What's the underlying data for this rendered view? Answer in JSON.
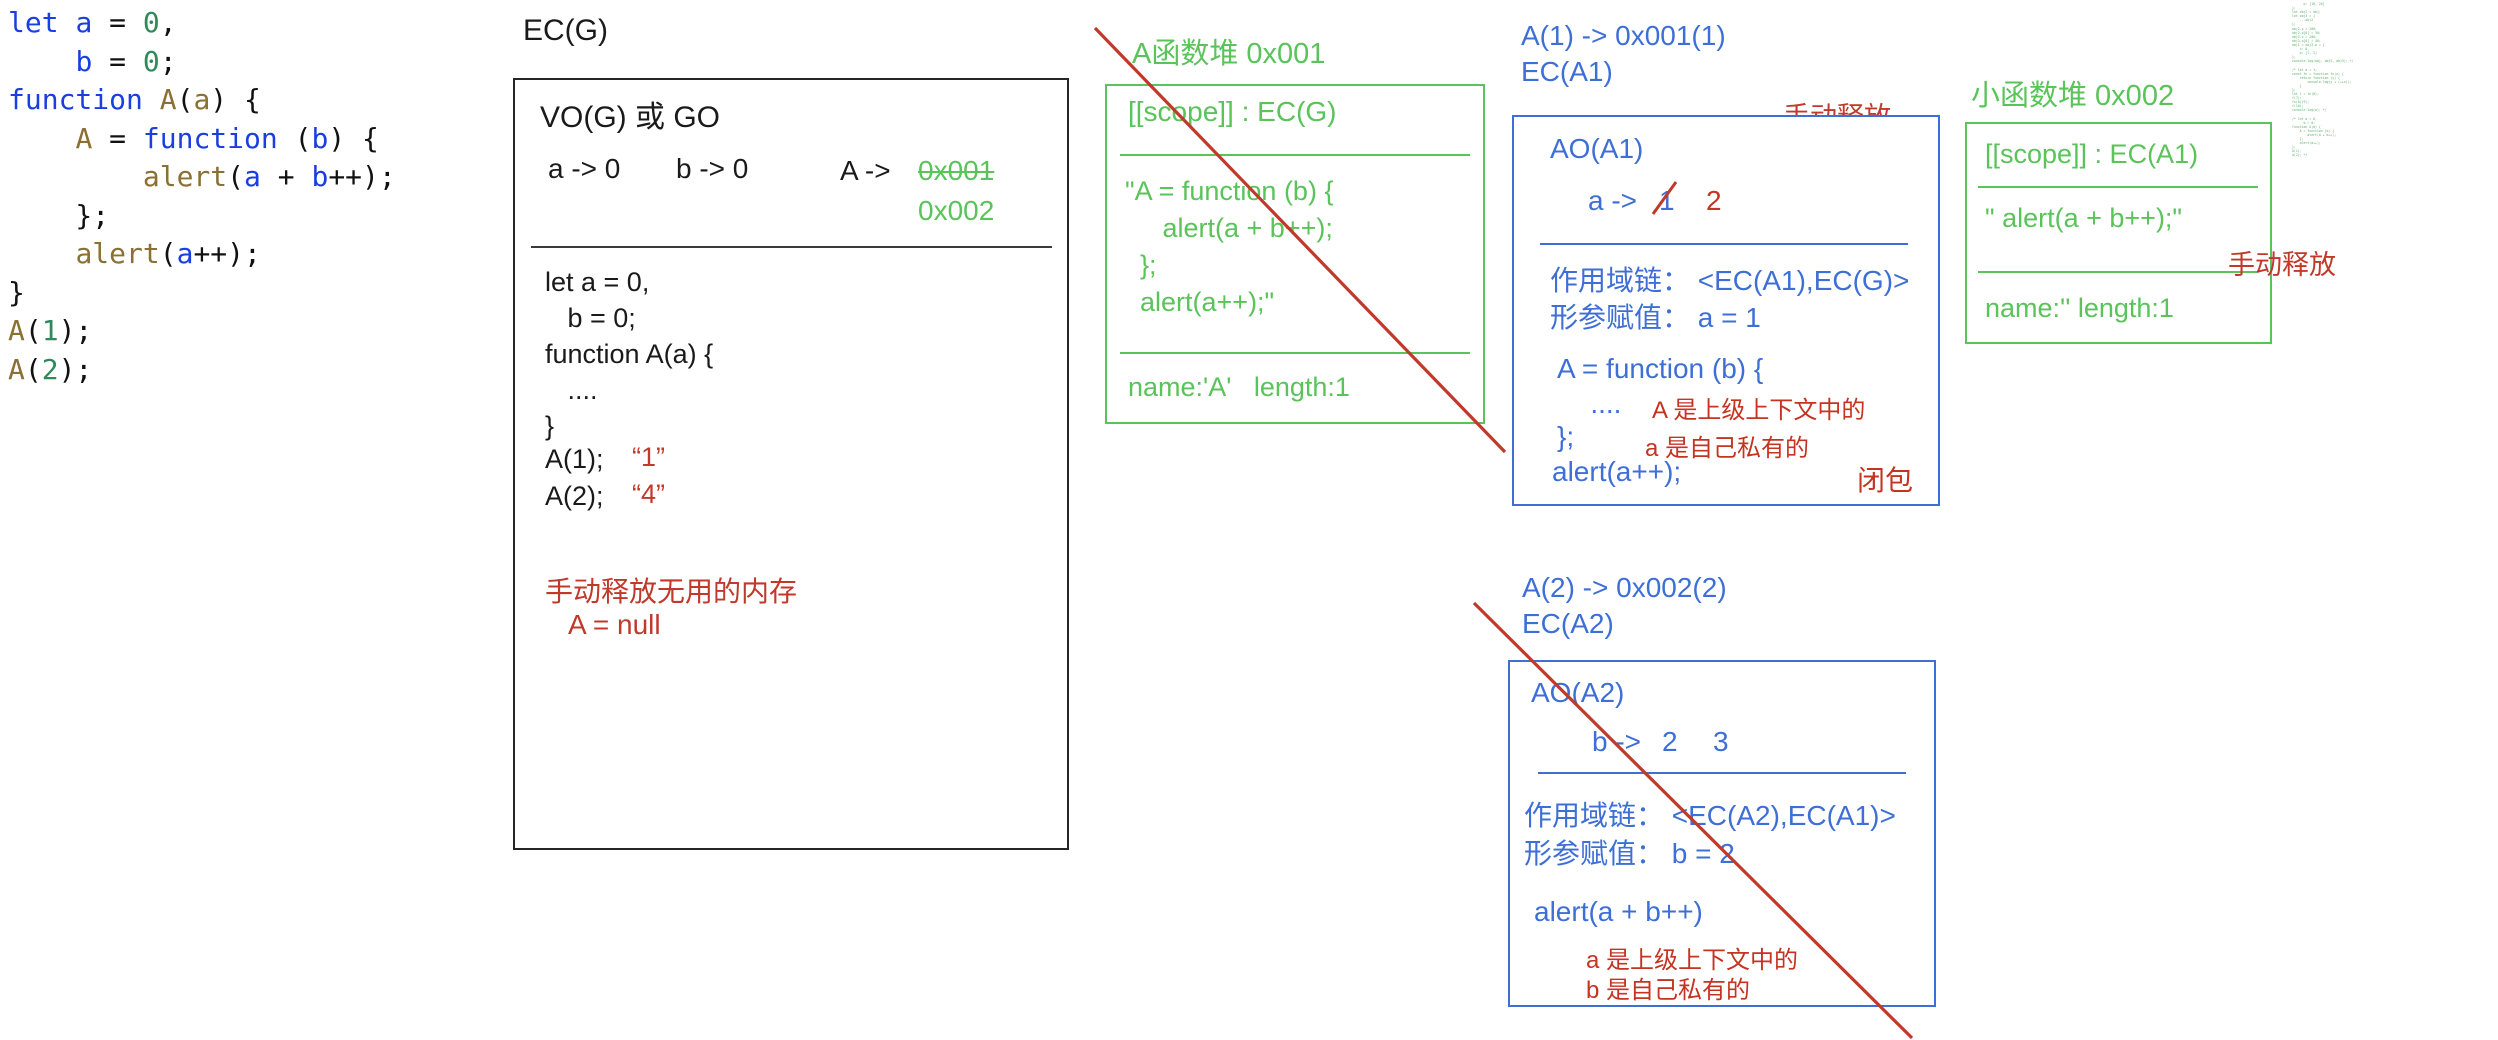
{
  "source_code": {
    "lines": [
      [
        {
          "t": "let ",
          "c": "kw"
        },
        {
          "t": "a",
          "c": "var"
        },
        {
          "t": " = ",
          "c": "pl"
        },
        {
          "t": "0",
          "c": "num"
        },
        {
          "t": ",",
          "c": "pl"
        }
      ],
      [
        {
          "t": "    ",
          "c": "pl"
        },
        {
          "t": "b",
          "c": "var"
        },
        {
          "t": " = ",
          "c": "pl"
        },
        {
          "t": "0",
          "c": "num"
        },
        {
          "t": ";",
          "c": "pl"
        }
      ],
      [
        {
          "t": "function ",
          "c": "kw"
        },
        {
          "t": "A",
          "c": "fn"
        },
        {
          "t": "(",
          "c": "pl"
        },
        {
          "t": "a",
          "c": "fn"
        },
        {
          "t": ") {",
          "c": "pl"
        }
      ],
      [
        {
          "t": "    ",
          "c": "pl"
        },
        {
          "t": "A",
          "c": "fn"
        },
        {
          "t": " = ",
          "c": "pl"
        },
        {
          "t": "function ",
          "c": "kw"
        },
        {
          "t": "(",
          "c": "pl"
        },
        {
          "t": "b",
          "c": "var"
        },
        {
          "t": ") {",
          "c": "pl"
        }
      ],
      [
        {
          "t": "        ",
          "c": "pl"
        },
        {
          "t": "alert",
          "c": "fn"
        },
        {
          "t": "(",
          "c": "pl"
        },
        {
          "t": "a",
          "c": "var"
        },
        {
          "t": " + ",
          "c": "pl"
        },
        {
          "t": "b",
          "c": "var"
        },
        {
          "t": "++);",
          "c": "pl"
        }
      ],
      [
        {
          "t": "    };",
          "c": "pl"
        }
      ],
      [
        {
          "t": "    ",
          "c": "pl"
        },
        {
          "t": "alert",
          "c": "fn"
        },
        {
          "t": "(",
          "c": "pl"
        },
        {
          "t": "a",
          "c": "var"
        },
        {
          "t": "++);",
          "c": "pl"
        }
      ],
      [
        {
          "t": "}",
          "c": "pl"
        }
      ],
      [
        {
          "t": "A",
          "c": "fn"
        },
        {
          "t": "(",
          "c": "pl"
        },
        {
          "t": "1",
          "c": "num"
        },
        {
          "t": ");",
          "c": "pl"
        }
      ],
      [
        {
          "t": "A",
          "c": "fn"
        },
        {
          "t": "(",
          "c": "pl"
        },
        {
          "t": "2",
          "c": "num"
        },
        {
          "t": ");",
          "c": "pl"
        }
      ]
    ]
  },
  "ec_g": {
    "title": "EC(G)",
    "vo_title": "VO(G) 或 GO",
    "var_a": "a -> 0",
    "var_b": "b -> 0",
    "var_A_label": "A ->",
    "var_A_old": "0x001",
    "var_A_new": "0x002",
    "body_lines": [
      "let a = 0,",
      "   b = 0;",
      "function A(a) {",
      "   ....",
      "}"
    ],
    "call_1": "A(1);",
    "call_1_out": "“1”",
    "call_2": "A(2);",
    "call_2_out": "“4”",
    "free_note_title": "手动释放无用的内存",
    "free_note_code": "A = null"
  },
  "heap_a": {
    "title": "A函数堆 0x001",
    "scope": "[[scope]] : EC(G)",
    "code_lines": [
      "\"A = function (b) {",
      "     alert(a + b++);",
      "  };",
      "  alert(a++);\""
    ],
    "meta": "name:'A'   length:1"
  },
  "heap_small": {
    "title": "小函数堆 0x002",
    "scope": "[[scope]] : EC(A1)",
    "code": "\" alert(a + b++);\"",
    "meta": "name:'' length:1",
    "release_note": "手动释放"
  },
  "ec_a1": {
    "head_line1": "A(1) -> 0x001(1)",
    "head_line2": "EC(A1)",
    "release_note": "手动释放",
    "ao_title": "AO(A1)",
    "var_name": "a ->",
    "var_old": "1",
    "var_new": "2",
    "scope_chain": "作用域链： <EC(A1),EC(G)>",
    "params": "形参赋值： a = 1",
    "body_line1": "A = function (b) {",
    "body_line2": "   ....",
    "body_line3": "};",
    "body_line4": "alert(a++);",
    "note1": "A 是上级上下文中的",
    "note2": "a 是自己私有的",
    "note3": "闭包"
  },
  "ec_a2": {
    "head_line1": "A(2) -> 0x002(2)",
    "head_line2": "EC(A2)",
    "ao_title": "AO(A2)",
    "var_name": "b ->",
    "var_old": "2",
    "var_new": "3",
    "scope_chain": "作用域链： <EC(A2),EC(A1)>",
    "params": "形参赋值： b = 2",
    "body_line1": "alert(a + b++)",
    "note1": "a 是上级上下文中的",
    "note2": "b 是自己私有的"
  },
  "micro_code": {
    "text": "      p: [10, 20]\n};\nlet obj2 = obj;\nlet obj3 = {\n    ...obj2\n};\nobj2.x = 200;\nobj2.p[0] = 30;\nobj3.x = 200;\nobj3.p[0] = 40;\nobj1 = obj3.p = {\n    x: 0,\n    p: [1, 2]\n};\nconsole.log(obj, obj2, obj3); */\n\n/* let a = 1;\nconst fn = function fn(x) {\n    return function (y) {\n        console.log(y + (++x));\n    }\n};\nlet f = fn(0);\nf(7);\nfn(0)(9);\nf(10);\nconsole.log(a); */\n\n/* let a = 0,\n      b = 0;\nfunction A(a) {\n    A = function (b) {\n        alert(a + b++);\n    };\n    alert(a++);\n};\nA(1);\nA(2); */"
  },
  "colors": {
    "green": "#5ac35a",
    "blue": "#3d6fd6",
    "red": "#c0392b",
    "black": "#1a1a1a"
  }
}
